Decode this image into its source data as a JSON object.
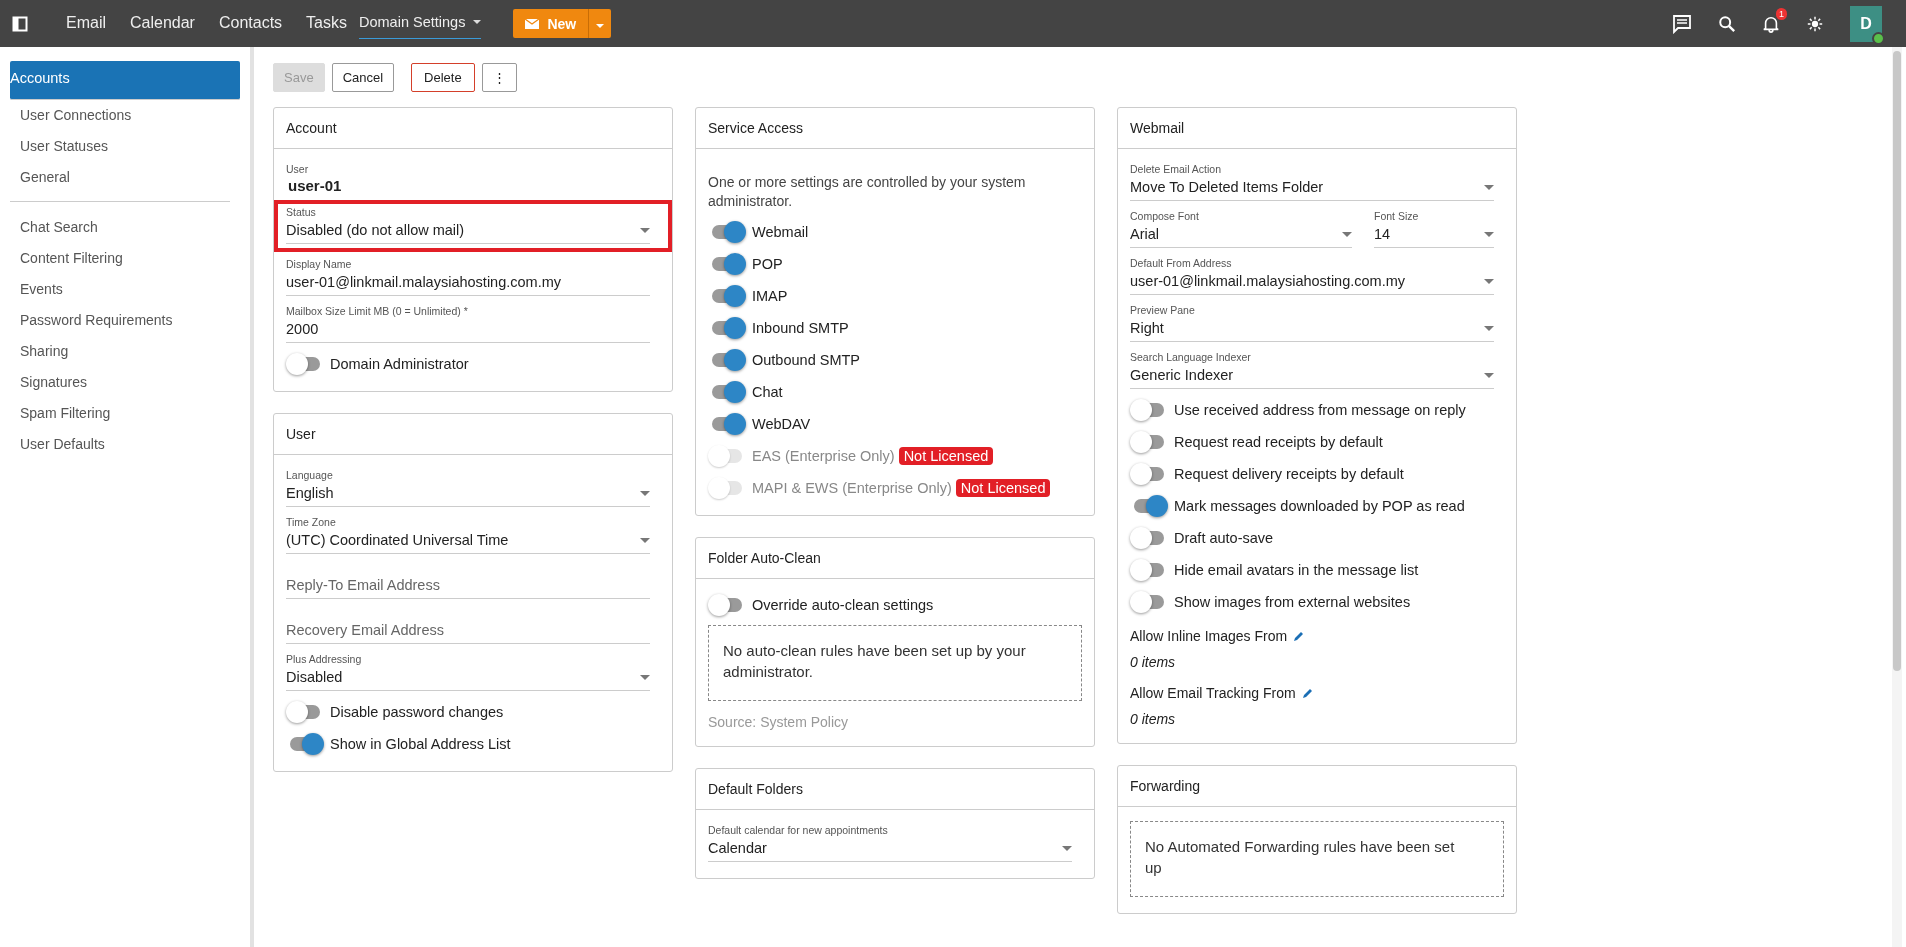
{
  "topbar": {
    "nav": [
      {
        "label": "Email",
        "selected": false,
        "dropdown": false
      },
      {
        "label": "Calendar",
        "selected": false,
        "dropdown": false
      },
      {
        "label": "Contacts",
        "selected": false,
        "dropdown": false
      },
      {
        "label": "Tasks",
        "selected": false,
        "dropdown": false
      },
      {
        "label": "Domain Settings",
        "selected": true,
        "dropdown": true
      }
    ],
    "new_button": "New",
    "notification_count": "1",
    "avatar": "D"
  },
  "sidebar": {
    "groups": [
      [
        {
          "label": "Accounts",
          "selected": true
        },
        {
          "label": "User Connections",
          "selected": false
        },
        {
          "label": "User Statuses",
          "selected": false
        },
        {
          "label": "General",
          "selected": false
        }
      ],
      [
        {
          "label": "Chat Search",
          "selected": false
        },
        {
          "label": "Content Filtering",
          "selected": false
        },
        {
          "label": "Events",
          "selected": false
        },
        {
          "label": "Password Requirements",
          "selected": false
        },
        {
          "label": "Sharing",
          "selected": false
        },
        {
          "label": "Signatures",
          "selected": false
        },
        {
          "label": "Spam Filtering",
          "selected": false
        },
        {
          "label": "User Defaults",
          "selected": false
        }
      ]
    ]
  },
  "toolbar": [
    {
      "label": "Save",
      "kind": "plain",
      "disabled": true
    },
    {
      "label": "Cancel",
      "kind": "plain",
      "disabled": false
    },
    {
      "label": "Delete",
      "kind": "danger",
      "disabled": false
    },
    {
      "label": "⋮",
      "kind": "plain",
      "disabled": false
    }
  ],
  "columns": [
    [
      {
        "title": "Account",
        "fields": [
          {
            "kind": "static",
            "label": "User",
            "value": "user-01"
          },
          {
            "kind": "select",
            "label": "Status",
            "value": "Disabled (do not allow mail)",
            "highlighted": true
          },
          {
            "kind": "text",
            "label": "Display Name",
            "value": "user-01@linkmail.malaysiahosting.com.my"
          },
          {
            "kind": "text",
            "label": "Mailbox Size Limit MB (0 = Unlimited) *",
            "value": "2000"
          },
          {
            "kind": "toggle",
            "label": "Domain Administrator",
            "on": false,
            "disabled": false
          }
        ]
      },
      {
        "title": "User",
        "fields": [
          {
            "kind": "select",
            "label": "Language",
            "value": "English"
          },
          {
            "kind": "select",
            "label": "Time Zone",
            "value": "(UTC) Coordinated Universal Time"
          },
          {
            "kind": "input",
            "placeholder": "Reply-To Email Address"
          },
          {
            "kind": "input",
            "placeholder": "Recovery Email Address"
          },
          {
            "kind": "select",
            "label": "Plus Addressing",
            "value": "Disabled"
          },
          {
            "kind": "toggle",
            "label": "Disable password changes",
            "on": false,
            "disabled": false
          },
          {
            "kind": "toggle",
            "label": "Show in Global Address List",
            "on": true,
            "disabled": false
          }
        ]
      }
    ],
    [
      {
        "title": "Service Access",
        "fields": [
          {
            "kind": "note",
            "value": "One or more settings are controlled by your system administrator."
          },
          {
            "kind": "toggle",
            "label": "Webmail",
            "on": true,
            "disabled": false
          },
          {
            "kind": "toggle",
            "label": "POP",
            "on": true,
            "disabled": false
          },
          {
            "kind": "toggle",
            "label": "IMAP",
            "on": true,
            "disabled": false
          },
          {
            "kind": "toggle",
            "label": "Inbound SMTP",
            "on": true,
            "disabled": false
          },
          {
            "kind": "toggle",
            "label": "Outbound SMTP",
            "on": true,
            "disabled": false
          },
          {
            "kind": "toggle",
            "label": "Chat",
            "on": true,
            "disabled": false
          },
          {
            "kind": "toggle",
            "label": "WebDAV",
            "on": true,
            "disabled": false
          },
          {
            "kind": "toggle",
            "label": "EAS (Enterprise Only)",
            "on": false,
            "disabled": true,
            "badge": "Not Licensed"
          },
          {
            "kind": "toggle",
            "label": "MAPI & EWS (Enterprise Only)",
            "on": false,
            "disabled": true,
            "badge": "Not Licensed"
          }
        ]
      },
      {
        "title": "Folder Auto-Clean",
        "fields": [
          {
            "kind": "toggle",
            "label": "Override auto-clean settings",
            "on": false,
            "disabled": false
          },
          {
            "kind": "dashed",
            "value": "No auto-clean rules have been set up by your administrator."
          },
          {
            "kind": "source",
            "value": "Source: System Policy"
          }
        ]
      },
      {
        "title": "Default Folders",
        "fields": [
          {
            "kind": "select",
            "label": "Default calendar for new appointments",
            "value": "Calendar"
          }
        ]
      }
    ],
    [
      {
        "title": "Webmail",
        "fields": [
          {
            "kind": "select",
            "label": "Delete Email Action",
            "value": "Move To Deleted Items Folder"
          },
          {
            "kind": "split",
            "parts": [
              {
                "label": "Compose Font",
                "value": "Arial"
              },
              {
                "label": "Font Size",
                "value": "14"
              }
            ]
          },
          {
            "kind": "select",
            "label": "Default From Address",
            "value": "user-01@linkmail.malaysiahosting.com.my"
          },
          {
            "kind": "select",
            "label": "Preview Pane",
            "value": "Right"
          },
          {
            "kind": "select",
            "label": "Search Language Indexer",
            "value": "Generic Indexer"
          },
          {
            "kind": "toggle",
            "label": "Use received address from message on reply",
            "on": false,
            "disabled": false
          },
          {
            "kind": "toggle",
            "label": "Request read receipts by default",
            "on": false,
            "disabled": false
          },
          {
            "kind": "toggle",
            "label": "Request delivery receipts by default",
            "on": false,
            "disabled": false
          },
          {
            "kind": "toggle",
            "label": "Mark messages downloaded by POP as read",
            "on": true,
            "disabled": false
          },
          {
            "kind": "toggle",
            "label": "Draft auto-save",
            "on": false,
            "disabled": false
          },
          {
            "kind": "toggle",
            "label": "Hide email avatars in the message list",
            "on": false,
            "disabled": false
          },
          {
            "kind": "toggle",
            "label": "Show images from external websites",
            "on": false,
            "disabled": false
          },
          {
            "kind": "list",
            "label": "Allow Inline Images From",
            "value": "0 items"
          },
          {
            "kind": "list",
            "label": "Allow Email Tracking From",
            "value": "0 items"
          }
        ]
      },
      {
        "title": "Forwarding",
        "fields": [
          {
            "kind": "dashed",
            "value": "No Automated Forwarding rules have been set up"
          }
        ]
      }
    ]
  ]
}
